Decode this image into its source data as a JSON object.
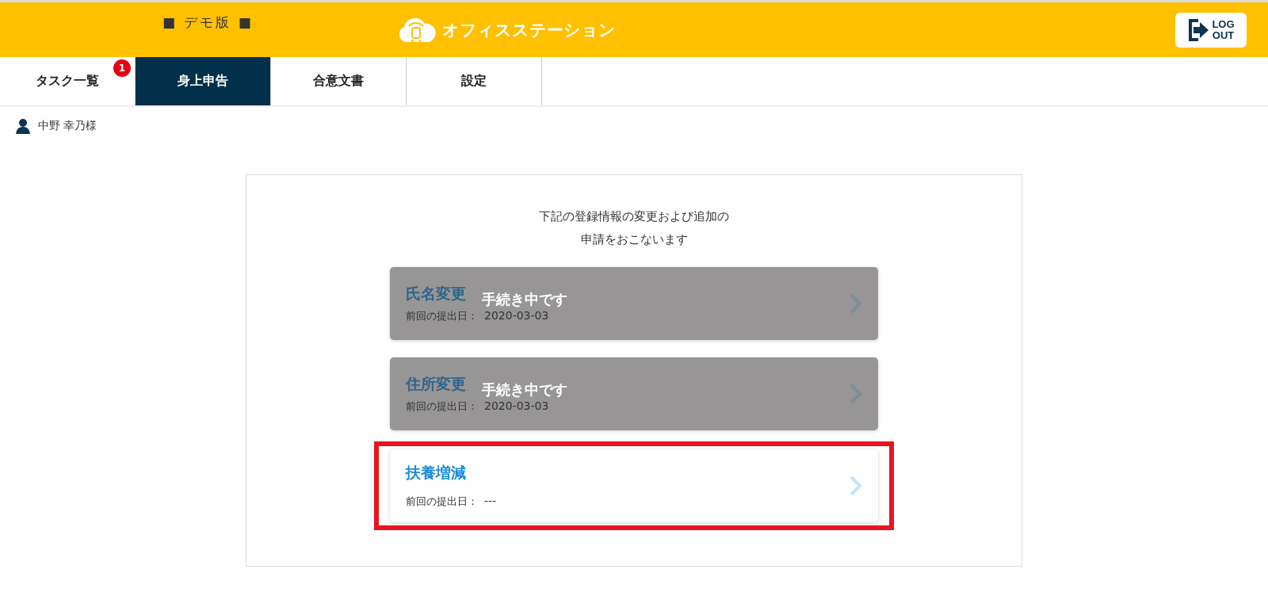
{
  "header": {
    "demo_label": "■ デモ版 ■",
    "app_name": "オフィスステーション",
    "logout": [
      "LOG",
      "OUT"
    ]
  },
  "tabs": [
    {
      "label": "タスク一覧",
      "selected": false,
      "badge": "1"
    },
    {
      "label": "身上申告",
      "selected": true
    },
    {
      "label": "合意文書",
      "selected": false
    },
    {
      "label": "設定",
      "selected": false
    }
  ],
  "user": {
    "name": "中野 幸乃様"
  },
  "panel": {
    "intro": [
      "下記の登録情報の変更および追加の",
      "申請をおこないます"
    ],
    "cards": [
      {
        "title": "氏名変更",
        "status": "手続き中です",
        "in_progress": true,
        "highlighted": false,
        "date_label": "前回の提出日：",
        "date": "2020-03-03"
      },
      {
        "title": "住所変更",
        "status": "手続き中です",
        "in_progress": true,
        "highlighted": false,
        "date_label": "前回の提出日：",
        "date": "2020-03-03"
      },
      {
        "title": "扶養増減",
        "in_progress": false,
        "highlighted": true,
        "date_label": "前回の提出日：",
        "date": "---"
      }
    ]
  }
}
